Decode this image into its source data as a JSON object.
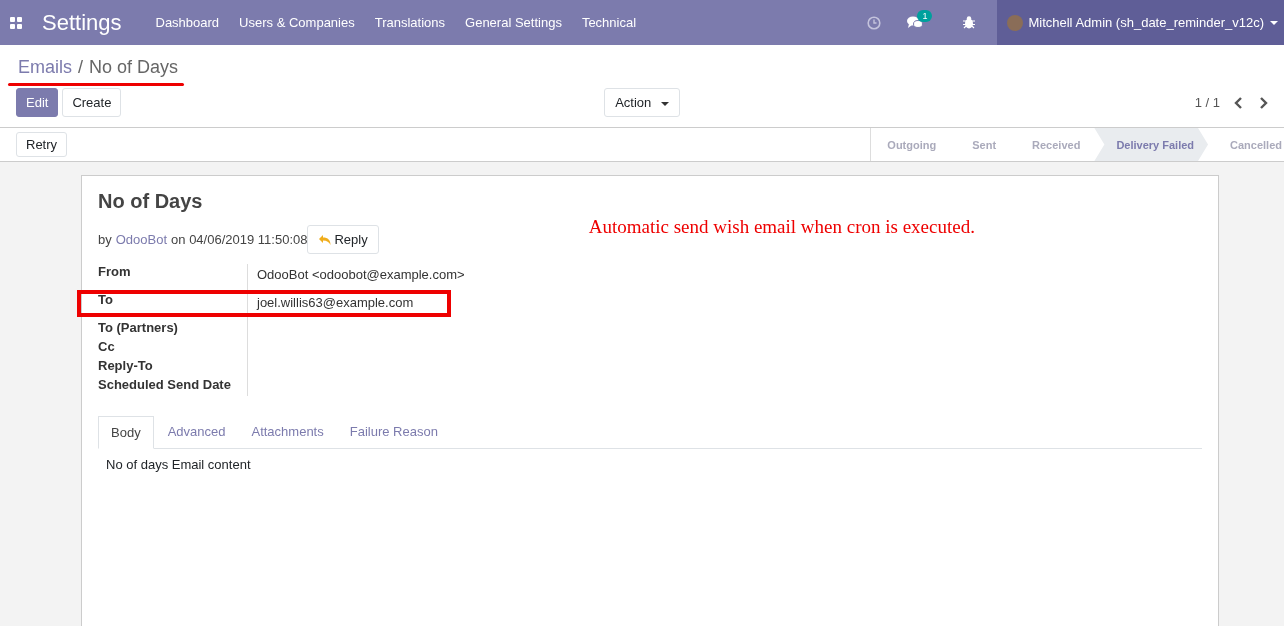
{
  "navbar": {
    "app_title": "Settings",
    "menu": [
      "Dashboard",
      "Users & Companies",
      "Translations",
      "General Settings",
      "Technical"
    ],
    "messages_badge": "1",
    "user": "Mitchell Admin (sh_date_reminder_v12c)"
  },
  "breadcrumb": {
    "parent": "Emails",
    "separator": "/",
    "current": "No of Days",
    "underlined": true
  },
  "buttons": {
    "edit": "Edit",
    "create": "Create",
    "action": "Action"
  },
  "pager": "1 / 1",
  "statusbar": {
    "button": "Retry",
    "stages": [
      {
        "label": "Outgoing",
        "selected": false
      },
      {
        "label": "Sent",
        "selected": false
      },
      {
        "label": "Received",
        "selected": false
      },
      {
        "label": "Delivery Failed",
        "selected": true
      },
      {
        "label": "Cancelled",
        "selected": false
      }
    ]
  },
  "sheet": {
    "title": "No of Days",
    "by": "by",
    "author": "OdooBot",
    "date": "on 04/06/2019 11:50:08",
    "reply": "Reply",
    "annotation": "Automatic send wish email when cron is executed.",
    "fields": [
      {
        "label": "From",
        "value": "OdooBot <odoobot@example.com>",
        "highlighted": false
      },
      {
        "label": "To",
        "value": "joel.willis63@example.com",
        "highlighted": true
      },
      {
        "label": "To (Partners)",
        "highlighted": false
      },
      {
        "label": "Cc",
        "highlighted": false
      },
      {
        "label": "Reply-To",
        "highlighted": false
      },
      {
        "label": "Scheduled Send Date",
        "highlighted": false
      }
    ],
    "tabs": [
      {
        "label": "Body",
        "selected": true
      },
      {
        "label": "Advanced",
        "selected": false
      },
      {
        "label": "Attachments",
        "selected": false
      },
      {
        "label": "Failure Reason",
        "selected": false
      }
    ],
    "body": "No of days Email content"
  }
}
